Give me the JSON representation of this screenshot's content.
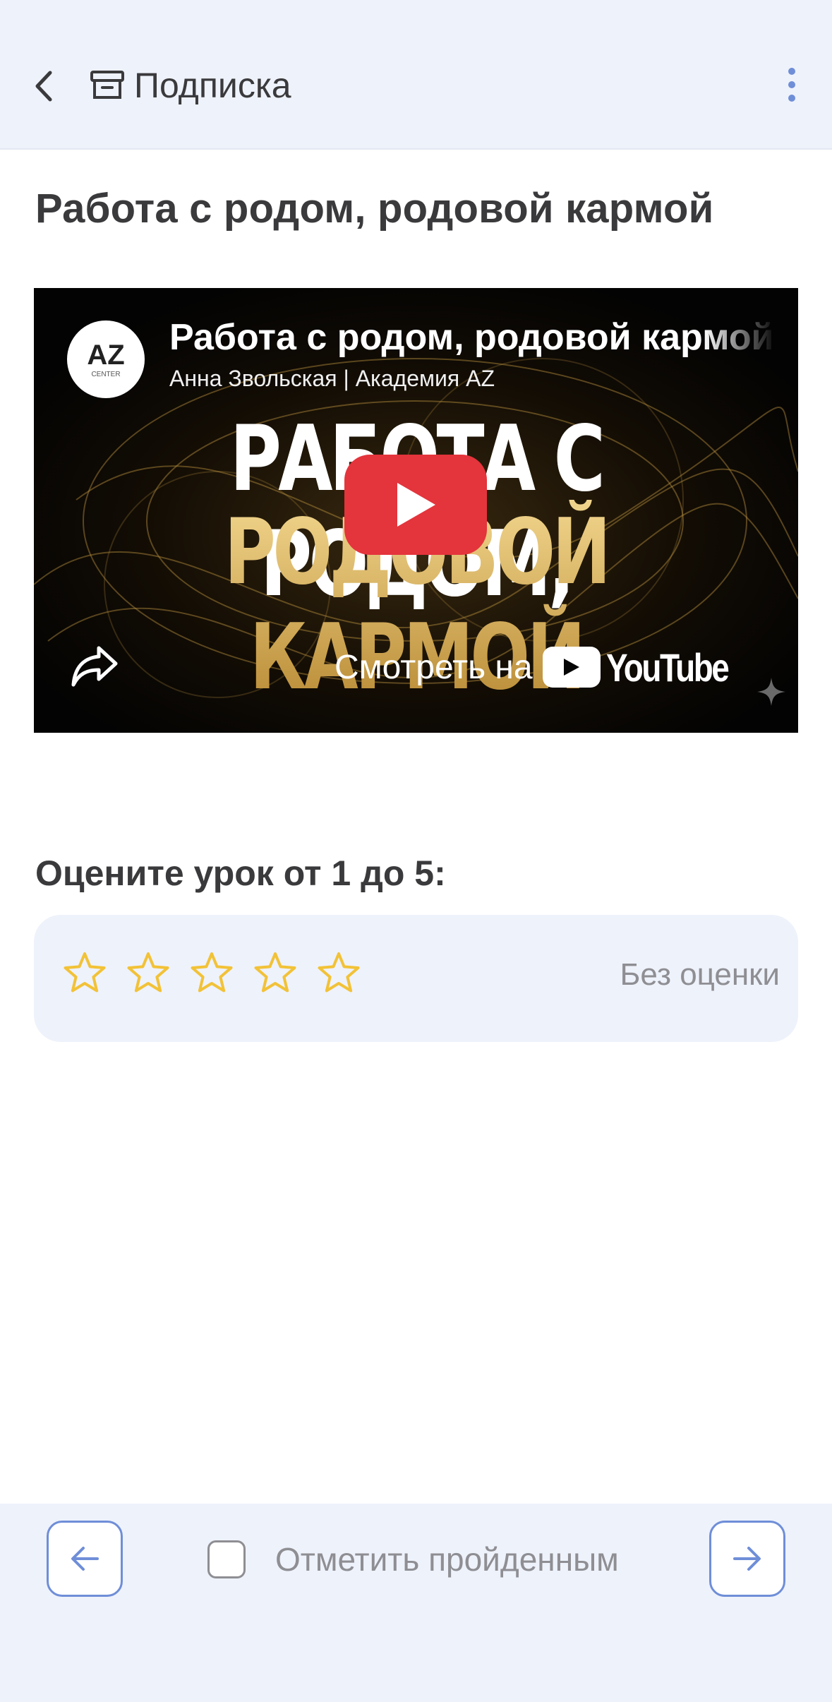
{
  "header": {
    "back_icon": "chevron-left-icon",
    "section_icon": "archive-box-icon",
    "title": "Подписка",
    "menu_icon": "more-vertical-icon",
    "accent_color": "#6f8ed8"
  },
  "lesson": {
    "title": "Работа с родом, родовой кармой"
  },
  "video": {
    "channel_logo_text": "AZ",
    "channel_logo_subtext": "CENTER",
    "title": "Работа с родом, родовой кармой",
    "author": "Анна Звольская | Академия AZ",
    "poster_line1": "РАБОТА С РОДОМ,",
    "poster_line2": "РОДОВОЙ КАРМОЙ",
    "play_icon": "play-icon",
    "share_icon": "share-icon",
    "watch_on_label": "Смотреть на",
    "platform_name": "YouTube",
    "play_button_color": "#e4343c"
  },
  "rating": {
    "label": "Оцените урок от 1 до 5:",
    "stars_total": 5,
    "stars_selected": 0,
    "status_text": "Без оценки",
    "star_color": "#f2c237"
  },
  "footer": {
    "prev_icon": "arrow-left-icon",
    "next_icon": "arrow-right-icon",
    "mark_done_label": "Отметить пройденным",
    "mark_done_checked": false
  }
}
